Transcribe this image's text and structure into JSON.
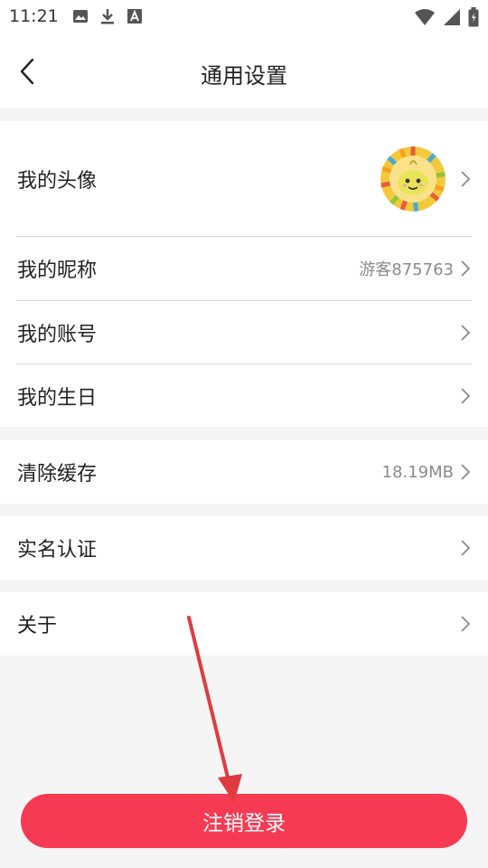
{
  "status_bar": {
    "time": "11:21",
    "icons_left": [
      "image-icon",
      "download-icon",
      "font-a-icon"
    ],
    "icons_right": [
      "wifi-icon",
      "signal-icon",
      "battery-icon"
    ]
  },
  "header": {
    "title": "通用设置",
    "back_icon": "chevron-left-icon"
  },
  "settings": {
    "avatar_label": "我的头像",
    "nickname_label": "我的昵称",
    "nickname_value": "游客875763",
    "account_label": "我的账号",
    "birthday_label": "我的生日",
    "clear_cache_label": "清除缓存",
    "cache_size": "18.19MB",
    "verification_label": "实名认证",
    "about_label": "关于"
  },
  "logout": {
    "label": "注销登录"
  },
  "colors": {
    "accent": "#f63a53",
    "annotation_arrow": "#e03a40",
    "page_bg": "#f5f5f5",
    "divider": "#d9d9d9",
    "secondary_text": "#8a8a8a"
  }
}
